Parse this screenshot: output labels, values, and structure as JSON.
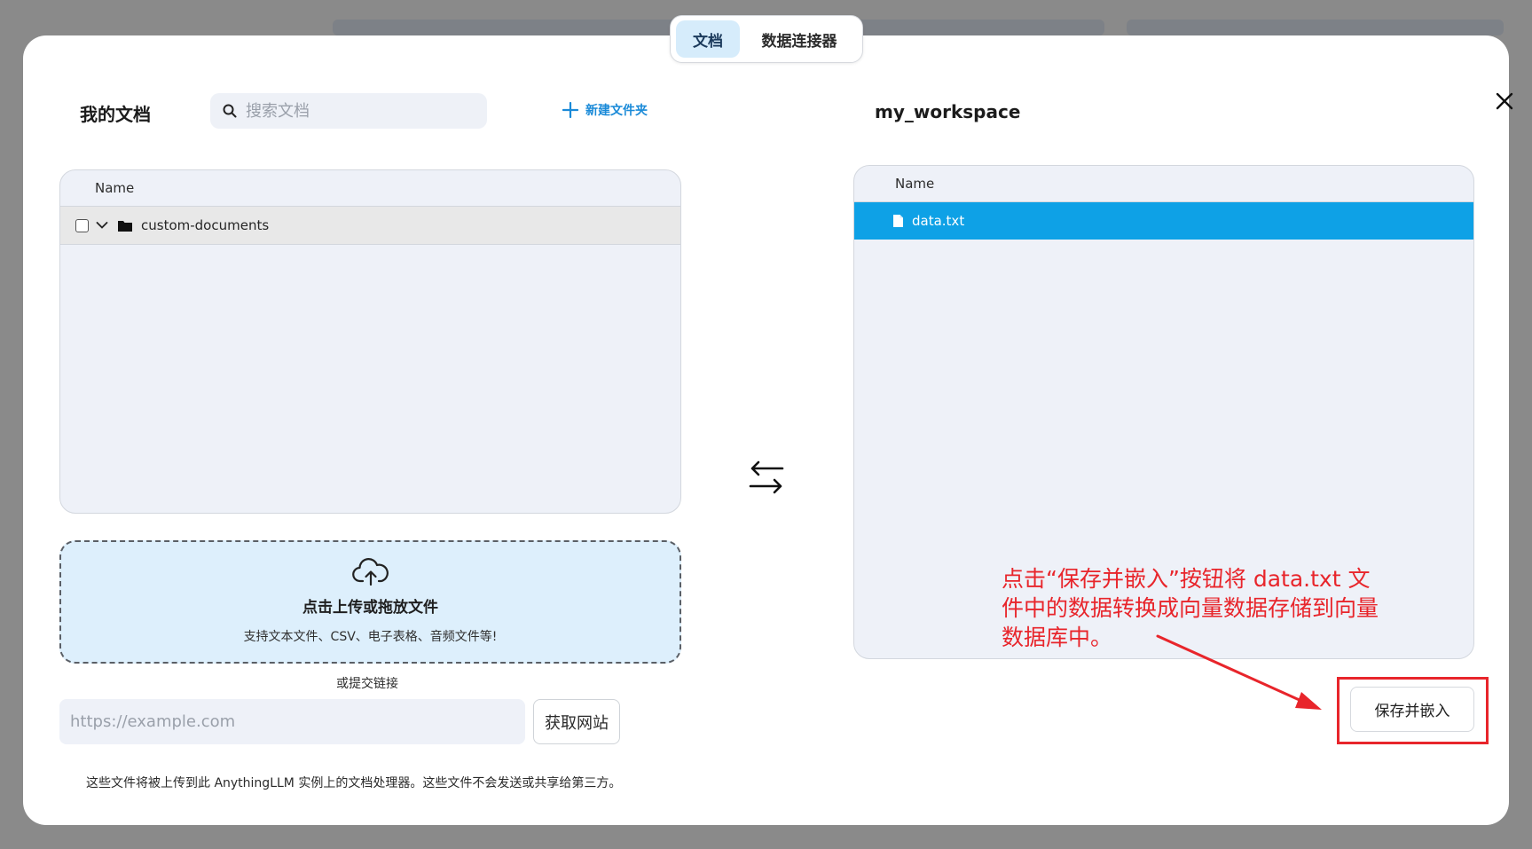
{
  "tabs": [
    {
      "label": "文档",
      "active": true
    },
    {
      "label": "数据连接器",
      "active": false
    }
  ],
  "left": {
    "title": "我的文档",
    "search_placeholder": "搜索文档",
    "new_folder_label": "新建文件夹",
    "column_name": "Name",
    "folder_name": "custom-documents"
  },
  "upload": {
    "title": "点击上传或拖放文件",
    "subtitle": "支持文本文件、CSV、电子表格、音频文件等!",
    "or_link": "或提交链接",
    "url_placeholder": "https://example.com",
    "fetch_label": "获取网站",
    "footnote": "这些文件将被上传到此 AnythingLLM 实例上的文档处理器。这些文件不会发送或共享给第三方。"
  },
  "right": {
    "title": "my_workspace",
    "column_name": "Name",
    "file_name": "data.txt",
    "save_label": "保存并嵌入"
  },
  "annotation": {
    "text": "点击“保存并嵌入”按钮将 data.txt 文件中的数据转换成向量数据存储到向量数据库中。"
  },
  "colors": {
    "accent": "#0ea1e6",
    "link": "#1a8ad8",
    "annotation": "#e8252b",
    "dropzone_bg": "#ddeffc"
  }
}
